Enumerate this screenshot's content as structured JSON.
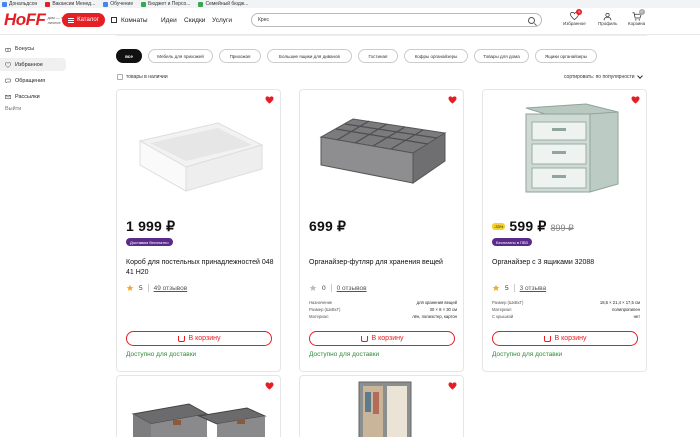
{
  "bookmarks": [
    {
      "label": "Дональдсон",
      "color": "#4285f4"
    },
    {
      "label": "Вакансии Менед...",
      "color": "#e31e24"
    },
    {
      "label": "Обучение",
      "color": "#4285f4"
    },
    {
      "label": "Бюджет и Персо...",
      "color": "#34a853"
    },
    {
      "label": "Семейный бюдж...",
      "color": "#34a853"
    }
  ],
  "header": {
    "logo": "HoFF",
    "logo_sub": "дом — это личное",
    "catalog": "Каталог",
    "rooms": "Комнаты",
    "nav": [
      "Идеи",
      "Скидки",
      "Услуги"
    ],
    "search_value": "Крес",
    "favorites_label": "Избранное",
    "favorites_count": "6",
    "profile_label": "Профиль",
    "cart_label": "Корзина",
    "cart_count": "0"
  },
  "sidebar": {
    "items": [
      {
        "label": "Бонусы",
        "icon": "gift-icon",
        "active": false
      },
      {
        "label": "Избранное",
        "icon": "heart-icon",
        "active": true
      },
      {
        "label": "Обращения",
        "icon": "chat-icon",
        "active": false
      },
      {
        "label": "Рассылки",
        "icon": "mail-icon",
        "active": false
      }
    ],
    "exit": "Выйти"
  },
  "filters": [
    "все",
    "Мебель для прихожей",
    "Прихожая",
    "Большие ящики для диванов",
    "Гостиная",
    "Кофры органайзеры",
    "Товары для дома",
    "Ящики органайзеры"
  ],
  "in_stock_label": "товары в наличии",
  "sort_label": "сортировать: по популярности",
  "products": [
    {
      "price": "1 999 ₽",
      "old_price": "",
      "discount": "",
      "badge": "Доставим бесплатно",
      "title": "Короб для постельных принадлежностей 048 41 H20",
      "rating": "5",
      "reviews": "49 отзывов",
      "specs": [],
      "cart": "В корзину",
      "availability": "Доступно для доставки"
    },
    {
      "price": "699 ₽",
      "old_price": "",
      "discount": "",
      "badge": "",
      "title": "Органайзер-футляр для хранения вещей",
      "rating": "0",
      "reviews": "0 отзывов",
      "specs": [
        {
          "key": "Назначение",
          "val": "для хранения вещей"
        },
        {
          "key": "Размер (ШхВхГ)",
          "val": "30 × 8 × 30 см"
        },
        {
          "key": "Материал",
          "val": "лён, полиэстер, картон"
        }
      ],
      "cart": "В корзину",
      "availability": "Доступно для доставки"
    },
    {
      "price": "599 ₽",
      "old_price": "899 ₽",
      "discount": "-33%",
      "badge": "Бесплатно в ПВЗ",
      "title": "Органайзер с 3 ящиками 32088",
      "rating": "5",
      "reviews": "3 отзыва",
      "specs": [
        {
          "key": "Размер (ШхВхГ)",
          "val": "18,6 × 21,4 × 17,5 см"
        },
        {
          "key": "Материал",
          "val": "полипропилен"
        },
        {
          "key": "С крышкой",
          "val": "нет"
        }
      ],
      "cart": "В корзину",
      "availability": "Доступно для доставки"
    }
  ],
  "colors": {
    "accent": "#e31e24",
    "badge": "#5b2b8a",
    "available": "#2e8b3a",
    "discount": "#f4d22a"
  }
}
